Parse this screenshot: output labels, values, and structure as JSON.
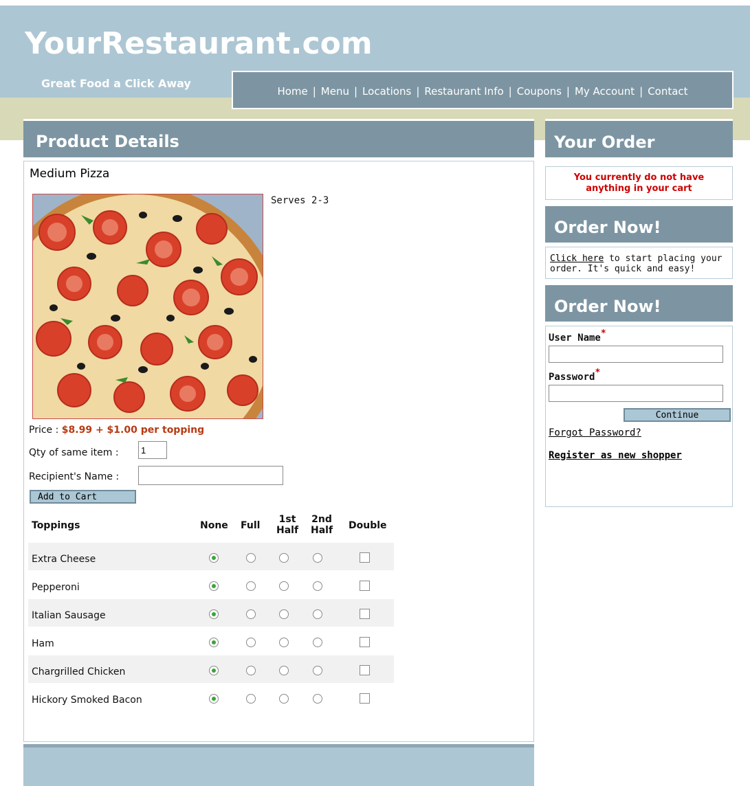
{
  "header": {
    "site_title": "YourRestaurant.com",
    "tagline": "Great Food a Click Away",
    "nav": [
      "Home",
      "Menu",
      "Locations",
      "Restaurant Info",
      "Coupons",
      "My Account",
      "Contact"
    ]
  },
  "main": {
    "heading": "Product Details",
    "product_name": "Medium Pizza",
    "serves": "Serves 2-3",
    "price_label": "Price : ",
    "price_value": "$8.99 + $1.00 per topping",
    "qty_label": "Qty of same item :",
    "qty_value": "1",
    "recipient_label": "Recipient's Name :",
    "recipient_value": "",
    "add_to_cart": "Add to Cart",
    "toppings_header": {
      "name": "Toppings",
      "none": "None",
      "full": "Full",
      "first_half": [
        "1st",
        "Half"
      ],
      "second_half": [
        "2nd",
        "Half"
      ],
      "double": "Double"
    },
    "toppings": [
      {
        "name": "Extra Cheese",
        "selected": "None",
        "double": false
      },
      {
        "name": "Pepperoni",
        "selected": "None",
        "double": false
      },
      {
        "name": "Italian Sausage",
        "selected": "None",
        "double": false
      },
      {
        "name": "Ham",
        "selected": "None",
        "double": false
      },
      {
        "name": "Chargrilled Chicken",
        "selected": "None",
        "double": false
      },
      {
        "name": "Hickory Smoked Bacon",
        "selected": "None",
        "double": false
      }
    ]
  },
  "sidebar": {
    "your_order": {
      "heading": "Your Order",
      "empty_line1": "You currently do not have",
      "empty_line2": "anything in your cart"
    },
    "order_now_1": {
      "heading": "Order Now!",
      "link": "Click here",
      "text_rest": " to start placing your order. It's quick and easy!"
    },
    "order_now_2": {
      "heading": "Order Now!",
      "username_label": "User Name",
      "password_label": "Password",
      "required_mark": "*",
      "continue": "Continue",
      "forgot": "Forgot Password?",
      "register": "Register as new shopper"
    }
  },
  "colors": {
    "header_bg": "#adc6d3",
    "panel_header": "#7d95a2",
    "band": "#d7d9b7",
    "price": "#b83a12",
    "alert": "#cc0000"
  }
}
